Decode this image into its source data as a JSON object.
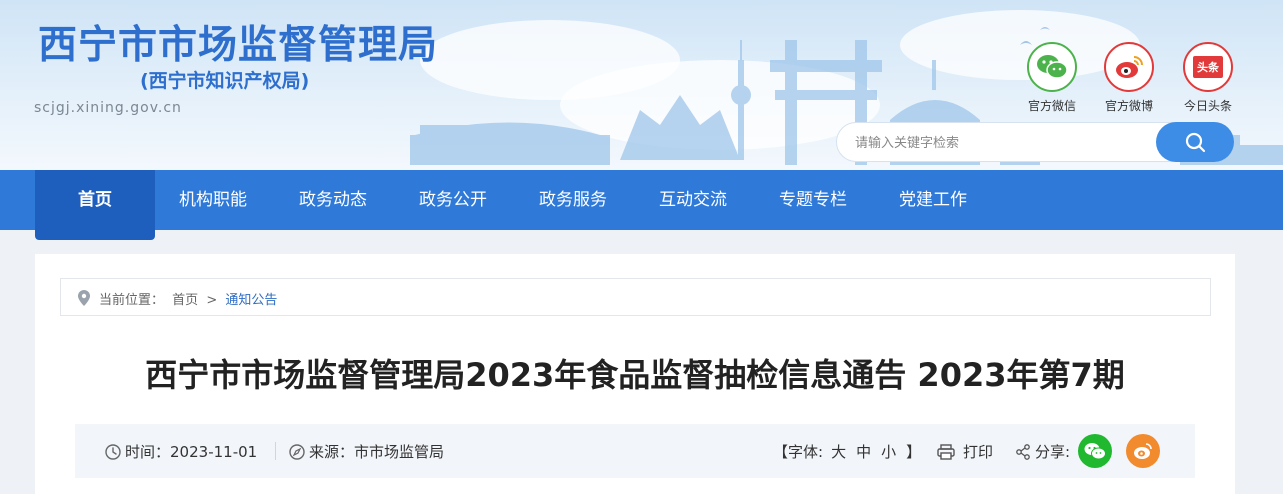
{
  "header": {
    "title": "西宁市市场监督管理局",
    "subtitle": "(西宁市知识产权局)",
    "domain": "scjgj.xining.gov.cn",
    "social": [
      {
        "label": "官方微信",
        "icon": "wechat-icon"
      },
      {
        "label": "官方微博",
        "icon": "weibo-icon"
      },
      {
        "label": "今日头条",
        "icon": "toutiao-icon",
        "badge": "头条"
      }
    ],
    "search": {
      "placeholder": "请输入关键字检索"
    }
  },
  "nav": {
    "items": [
      "首页",
      "机构职能",
      "政务动态",
      "政务公开",
      "政务服务",
      "互动交流",
      "专题专栏",
      "党建工作"
    ],
    "active": "首页"
  },
  "breadcrumb": {
    "label": "当前位置：",
    "home": "首页",
    "sep": ">",
    "current": "通知公告"
  },
  "article": {
    "title": "西宁市市场监督管理局2023年食品监督抽检信息通告 2023年第7期",
    "time_label": "时间：",
    "time": "2023-11-01",
    "source_label": "来源：",
    "source": "市市场监管局",
    "font_label": "【字体:",
    "font_large": "大",
    "font_medium": "中",
    "font_small": "小",
    "font_close": "】",
    "print": "打印",
    "share": "分享:"
  },
  "colors": {
    "brand_blue": "#2e6fce",
    "nav_blue": "#2f7ad9",
    "nav_active": "#1e5fbe",
    "wechat_green": "#1fb82e",
    "weibo_orange": "#f28a2e"
  }
}
